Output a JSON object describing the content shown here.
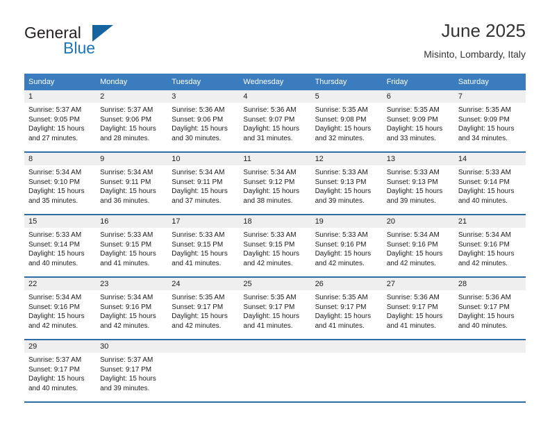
{
  "brand": {
    "name_top": "General",
    "name_bottom": "Blue",
    "accent_color": "#1c74bb",
    "triangle_color": "#15639f",
    "triangle_icon": "triangle-icon"
  },
  "header": {
    "title": "June 2025",
    "subtitle": "Misinto, Lombardy, Italy"
  },
  "theme": {
    "header_bg": "#3a7cbe",
    "row_divider": "#2e6da4",
    "daynum_bg": "#efefef",
    "text": "#1a1a1a"
  },
  "weekday_headers": [
    "Sunday",
    "Monday",
    "Tuesday",
    "Wednesday",
    "Thursday",
    "Friday",
    "Saturday"
  ],
  "weeks": [
    [
      {
        "day": "1",
        "sunrise": "Sunrise: 5:37 AM",
        "sunset": "Sunset: 9:05 PM",
        "daylight_1": "Daylight: 15 hours",
        "daylight_2": "and 27 minutes."
      },
      {
        "day": "2",
        "sunrise": "Sunrise: 5:37 AM",
        "sunset": "Sunset: 9:06 PM",
        "daylight_1": "Daylight: 15 hours",
        "daylight_2": "and 28 minutes."
      },
      {
        "day": "3",
        "sunrise": "Sunrise: 5:36 AM",
        "sunset": "Sunset: 9:06 PM",
        "daylight_1": "Daylight: 15 hours",
        "daylight_2": "and 30 minutes."
      },
      {
        "day": "4",
        "sunrise": "Sunrise: 5:36 AM",
        "sunset": "Sunset: 9:07 PM",
        "daylight_1": "Daylight: 15 hours",
        "daylight_2": "and 31 minutes."
      },
      {
        "day": "5",
        "sunrise": "Sunrise: 5:35 AM",
        "sunset": "Sunset: 9:08 PM",
        "daylight_1": "Daylight: 15 hours",
        "daylight_2": "and 32 minutes."
      },
      {
        "day": "6",
        "sunrise": "Sunrise: 5:35 AM",
        "sunset": "Sunset: 9:09 PM",
        "daylight_1": "Daylight: 15 hours",
        "daylight_2": "and 33 minutes."
      },
      {
        "day": "7",
        "sunrise": "Sunrise: 5:35 AM",
        "sunset": "Sunset: 9:09 PM",
        "daylight_1": "Daylight: 15 hours",
        "daylight_2": "and 34 minutes."
      }
    ],
    [
      {
        "day": "8",
        "sunrise": "Sunrise: 5:34 AM",
        "sunset": "Sunset: 9:10 PM",
        "daylight_1": "Daylight: 15 hours",
        "daylight_2": "and 35 minutes."
      },
      {
        "day": "9",
        "sunrise": "Sunrise: 5:34 AM",
        "sunset": "Sunset: 9:11 PM",
        "daylight_1": "Daylight: 15 hours",
        "daylight_2": "and 36 minutes."
      },
      {
        "day": "10",
        "sunrise": "Sunrise: 5:34 AM",
        "sunset": "Sunset: 9:11 PM",
        "daylight_1": "Daylight: 15 hours",
        "daylight_2": "and 37 minutes."
      },
      {
        "day": "11",
        "sunrise": "Sunrise: 5:34 AM",
        "sunset": "Sunset: 9:12 PM",
        "daylight_1": "Daylight: 15 hours",
        "daylight_2": "and 38 minutes."
      },
      {
        "day": "12",
        "sunrise": "Sunrise: 5:33 AM",
        "sunset": "Sunset: 9:13 PM",
        "daylight_1": "Daylight: 15 hours",
        "daylight_2": "and 39 minutes."
      },
      {
        "day": "13",
        "sunrise": "Sunrise: 5:33 AM",
        "sunset": "Sunset: 9:13 PM",
        "daylight_1": "Daylight: 15 hours",
        "daylight_2": "and 39 minutes."
      },
      {
        "day": "14",
        "sunrise": "Sunrise: 5:33 AM",
        "sunset": "Sunset: 9:14 PM",
        "daylight_1": "Daylight: 15 hours",
        "daylight_2": "and 40 minutes."
      }
    ],
    [
      {
        "day": "15",
        "sunrise": "Sunrise: 5:33 AM",
        "sunset": "Sunset: 9:14 PM",
        "daylight_1": "Daylight: 15 hours",
        "daylight_2": "and 40 minutes."
      },
      {
        "day": "16",
        "sunrise": "Sunrise: 5:33 AM",
        "sunset": "Sunset: 9:15 PM",
        "daylight_1": "Daylight: 15 hours",
        "daylight_2": "and 41 minutes."
      },
      {
        "day": "17",
        "sunrise": "Sunrise: 5:33 AM",
        "sunset": "Sunset: 9:15 PM",
        "daylight_1": "Daylight: 15 hours",
        "daylight_2": "and 41 minutes."
      },
      {
        "day": "18",
        "sunrise": "Sunrise: 5:33 AM",
        "sunset": "Sunset: 9:15 PM",
        "daylight_1": "Daylight: 15 hours",
        "daylight_2": "and 42 minutes."
      },
      {
        "day": "19",
        "sunrise": "Sunrise: 5:33 AM",
        "sunset": "Sunset: 9:16 PM",
        "daylight_1": "Daylight: 15 hours",
        "daylight_2": "and 42 minutes."
      },
      {
        "day": "20",
        "sunrise": "Sunrise: 5:34 AM",
        "sunset": "Sunset: 9:16 PM",
        "daylight_1": "Daylight: 15 hours",
        "daylight_2": "and 42 minutes."
      },
      {
        "day": "21",
        "sunrise": "Sunrise: 5:34 AM",
        "sunset": "Sunset: 9:16 PM",
        "daylight_1": "Daylight: 15 hours",
        "daylight_2": "and 42 minutes."
      }
    ],
    [
      {
        "day": "22",
        "sunrise": "Sunrise: 5:34 AM",
        "sunset": "Sunset: 9:16 PM",
        "daylight_1": "Daylight: 15 hours",
        "daylight_2": "and 42 minutes."
      },
      {
        "day": "23",
        "sunrise": "Sunrise: 5:34 AM",
        "sunset": "Sunset: 9:16 PM",
        "daylight_1": "Daylight: 15 hours",
        "daylight_2": "and 42 minutes."
      },
      {
        "day": "24",
        "sunrise": "Sunrise: 5:35 AM",
        "sunset": "Sunset: 9:17 PM",
        "daylight_1": "Daylight: 15 hours",
        "daylight_2": "and 42 minutes."
      },
      {
        "day": "25",
        "sunrise": "Sunrise: 5:35 AM",
        "sunset": "Sunset: 9:17 PM",
        "daylight_1": "Daylight: 15 hours",
        "daylight_2": "and 41 minutes."
      },
      {
        "day": "26",
        "sunrise": "Sunrise: 5:35 AM",
        "sunset": "Sunset: 9:17 PM",
        "daylight_1": "Daylight: 15 hours",
        "daylight_2": "and 41 minutes."
      },
      {
        "day": "27",
        "sunrise": "Sunrise: 5:36 AM",
        "sunset": "Sunset: 9:17 PM",
        "daylight_1": "Daylight: 15 hours",
        "daylight_2": "and 41 minutes."
      },
      {
        "day": "28",
        "sunrise": "Sunrise: 5:36 AM",
        "sunset": "Sunset: 9:17 PM",
        "daylight_1": "Daylight: 15 hours",
        "daylight_2": "and 40 minutes."
      }
    ],
    [
      {
        "day": "29",
        "sunrise": "Sunrise: 5:37 AM",
        "sunset": "Sunset: 9:17 PM",
        "daylight_1": "Daylight: 15 hours",
        "daylight_2": "and 40 minutes."
      },
      {
        "day": "30",
        "sunrise": "Sunrise: 5:37 AM",
        "sunset": "Sunset: 9:17 PM",
        "daylight_1": "Daylight: 15 hours",
        "daylight_2": "and 39 minutes."
      },
      {
        "day": "",
        "sunrise": "",
        "sunset": "",
        "daylight_1": "",
        "daylight_2": ""
      },
      {
        "day": "",
        "sunrise": "",
        "sunset": "",
        "daylight_1": "",
        "daylight_2": ""
      },
      {
        "day": "",
        "sunrise": "",
        "sunset": "",
        "daylight_1": "",
        "daylight_2": ""
      },
      {
        "day": "",
        "sunrise": "",
        "sunset": "",
        "daylight_1": "",
        "daylight_2": ""
      },
      {
        "day": "",
        "sunrise": "",
        "sunset": "",
        "daylight_1": "",
        "daylight_2": ""
      }
    ]
  ]
}
